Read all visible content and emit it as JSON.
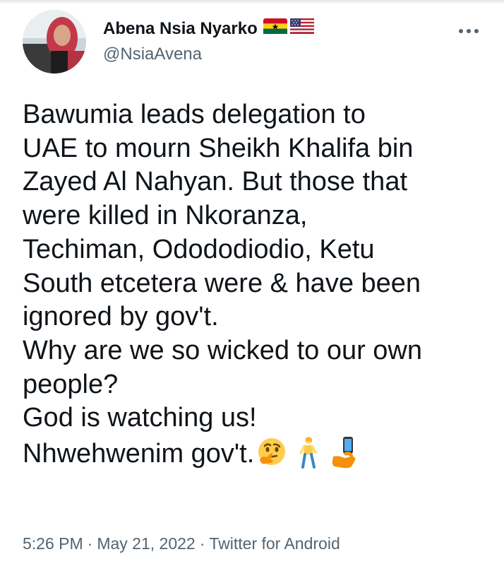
{
  "tweet": {
    "author": {
      "display_name": "Abena Nsia Nyarko",
      "handle": "@NsiaAvena",
      "flags": [
        "ghana-flag",
        "usa-flag"
      ],
      "avatar": "profile-photo"
    },
    "text_lines": [
      "Bawumia leads delegation to",
      "UAE to mourn Sheikh Khalifa bin",
      "Zayed Al Nahyan. But those that",
      "were killed in Nkoranza,",
      "Techiman, Odododiodio, Ketu",
      "South etcetera were & have been",
      "ignored by gov't.",
      "Why are we so wicked to our own",
      "people?",
      "God is watching us!",
      "Nhwehwenim gov't."
    ],
    "emojis": [
      "thinking-face-emoji",
      "person-walking-emoji",
      "selfie-emoji"
    ],
    "time": "5:26 PM",
    "date": "May 21, 2022",
    "source": "Twitter for Android",
    "separator": "·"
  },
  "colors": {
    "text_primary": "#0f1419",
    "text_secondary": "#536471",
    "background": "#ffffff"
  }
}
